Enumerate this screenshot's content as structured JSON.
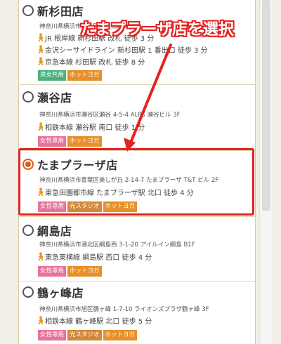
{
  "callout": "たまプラーザ店を選択",
  "stores": [
    {
      "name": "新杉田店",
      "address": "神奈川県横浜市磯子区新杉田町8-8",
      "access": [
        "JR 根岸線 新杉田駅 改札 徒歩 3 分",
        "金沢シーサイドライン 新杉田駅 1 番出口 徒歩 3 分",
        "京急本線 杉田駅 改札 徒歩 8 分"
      ],
      "tags": [
        {
          "label": "男女共用",
          "color": "green"
        },
        {
          "label": "ホットヨガ",
          "color": "orange"
        }
      ],
      "selected": false
    },
    {
      "name": "瀬谷店",
      "address": "神奈川県横浜市瀬谷区瀬谷 4-5-4 ALPS 瀬谷ビル 3F",
      "access": [
        "相鉄本線 瀬谷駅 南口 徒歩 1 分"
      ],
      "tags": [
        {
          "label": "女性専用",
          "color": "pink"
        },
        {
          "label": "ホットヨガ",
          "color": "orange"
        }
      ],
      "selected": false
    },
    {
      "name": "たまプラーザ店",
      "address": "神奈川県横浜市青葉区美しが丘 2-14-7 たまプラーザ T&T ビル 2F",
      "access": [
        "東急田園都市線 たまプラーザ駅 北口 徒歩 4 分"
      ],
      "tags": [
        {
          "label": "女性専用",
          "color": "pink"
        },
        {
          "label": "光スタジオ",
          "color": "brown"
        },
        {
          "label": "ホットヨガ",
          "color": "orange"
        }
      ],
      "selected": true
    },
    {
      "name": "綱島店",
      "address": "神奈川県横浜市港北区綱島西 3-1-20 アイルイン綱島 B1F",
      "access": [
        "東急東横線 綱島駅 西口 徒歩 4 分"
      ],
      "tags": [
        {
          "label": "女性専用",
          "color": "pink"
        },
        {
          "label": "ホットヨガ",
          "color": "orange"
        }
      ],
      "selected": false
    },
    {
      "name": "鶴ヶ峰店",
      "address": "神奈川県横浜市旭区鶴ヶ峰 1-7-10 ライオンズプラザ鶴ヶ峰 3F",
      "access": [
        "相鉄本線 鶴ヶ峰駅 北口 徒歩 5 分"
      ],
      "tags": [
        {
          "label": "女性専用",
          "color": "pink"
        },
        {
          "label": "光スタジオ",
          "color": "brown"
        },
        {
          "label": "ホットヨガ",
          "color": "orange"
        }
      ],
      "selected": false
    }
  ]
}
